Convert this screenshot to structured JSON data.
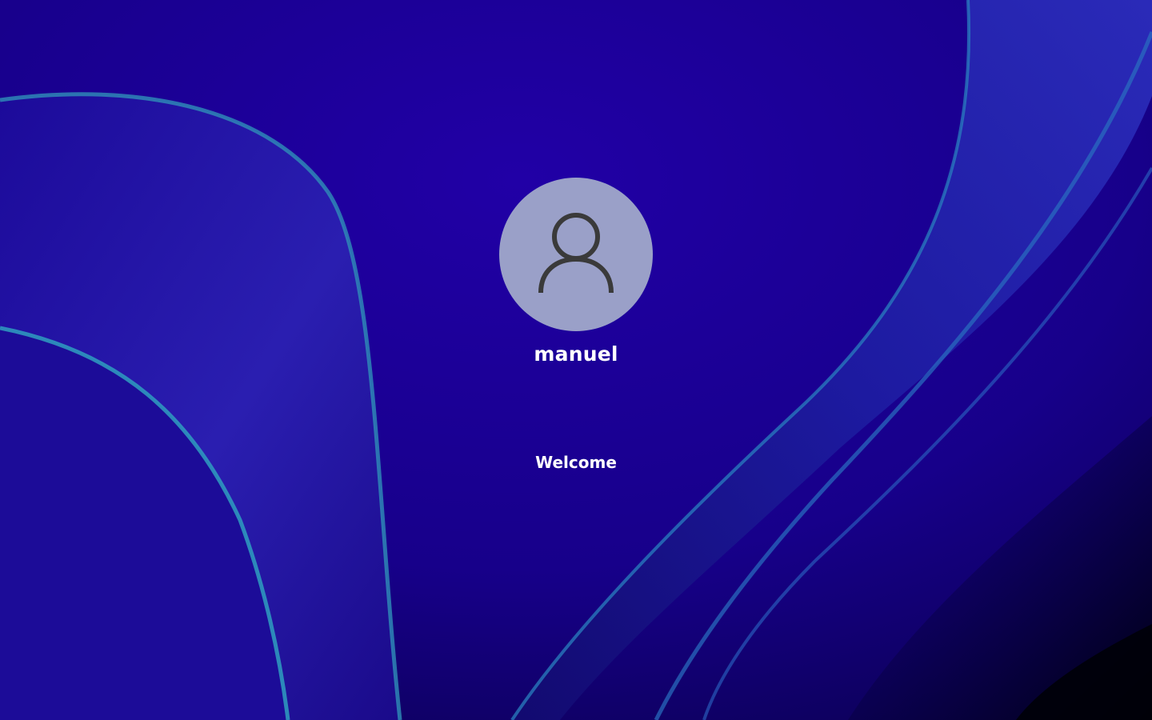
{
  "lock_screen": {
    "user": {
      "name": "manuel",
      "avatar_icon": "user-silhouette-icon"
    },
    "status_text": "Welcome"
  },
  "colors": {
    "background": "#1b0096",
    "avatar_fill": "#9aa0c8",
    "avatar_icon": "#3a3a3a",
    "text": "#ffffff"
  }
}
